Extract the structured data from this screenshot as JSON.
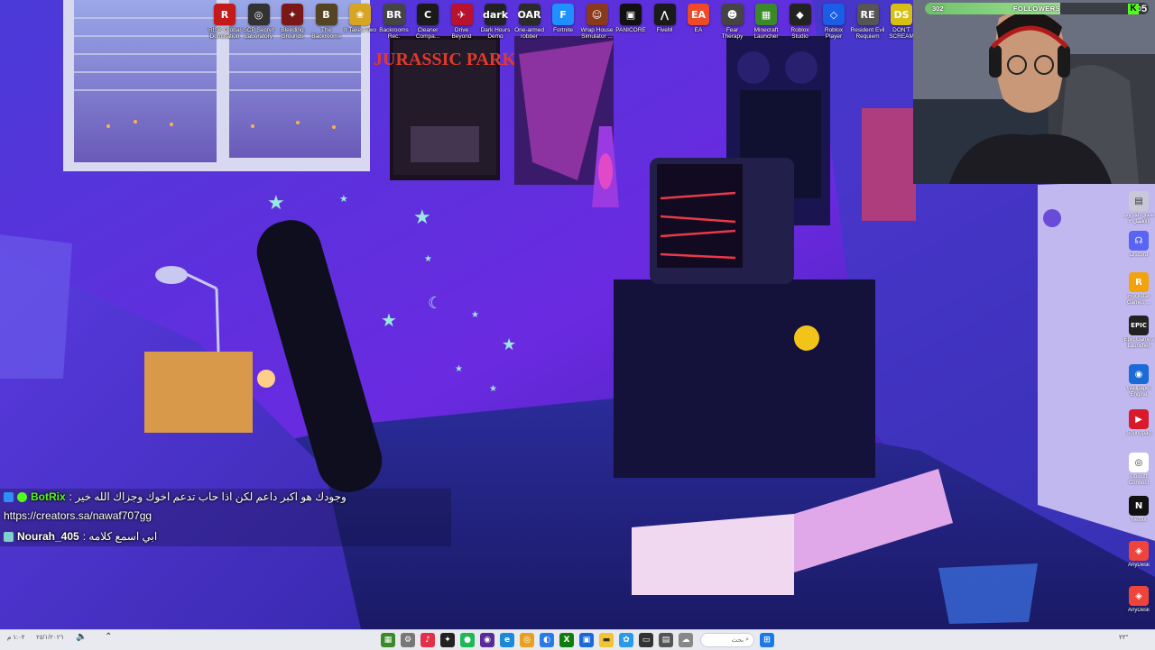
{
  "desktop_icons_top": [
    {
      "label": "RISK Global Domination",
      "icon": "risk-icon",
      "color": "#c41a1a",
      "glyph": "R"
    },
    {
      "label": "SCP Secret Laboratory",
      "icon": "scp-icon",
      "color": "#333333",
      "glyph": "◎"
    },
    {
      "label": "Bleeding Grounds",
      "icon": "bleed-icon",
      "color": "#7a1818",
      "glyph": "✦"
    },
    {
      "label": "The Backrooms",
      "icon": "backrooms-icon",
      "color": "#554422",
      "glyph": "B"
    },
    {
      "label": "It Takes Two",
      "icon": "ittakestwo-icon",
      "color": "#d6a524",
      "glyph": "❀"
    },
    {
      "label": "Backrooms Rec.",
      "icon": "br-icon",
      "color": "#444444",
      "glyph": "BR"
    },
    {
      "label": "Cleaner Compa...",
      "icon": "cleaner-icon",
      "color": "#1a1a1a",
      "glyph": "C"
    },
    {
      "label": "Drive Beyond Horizons",
      "icon": "drive-icon",
      "color": "#b8122e",
      "glyph": "✈"
    },
    {
      "label": "Dark Hours Demo",
      "icon": "darkhours-icon",
      "color": "#222222",
      "glyph": "dark"
    },
    {
      "label": "One-armed robber",
      "icon": "robber-icon",
      "color": "#2a2a2a",
      "glyph": "OAR"
    },
    {
      "label": "Fortnite",
      "icon": "fortnite-icon",
      "color": "#1e90ff",
      "glyph": "F"
    },
    {
      "label": "Wrap House Simulator ...",
      "icon": "wraphouse-icon",
      "color": "#8a3a1a",
      "glyph": "☺"
    },
    {
      "label": "PANICORE",
      "icon": "panicore-icon",
      "color": "#111111",
      "glyph": "▣"
    },
    {
      "label": "FiveM",
      "icon": "fivem-icon",
      "color": "#1a1a1a",
      "glyph": "⋀"
    },
    {
      "label": "EA",
      "icon": "ea-icon",
      "color": "#ef4a27",
      "glyph": "EA"
    },
    {
      "label": "Fear Therapy",
      "icon": "feartherapy-icon",
      "color": "#444444",
      "glyph": "☻"
    },
    {
      "label": "Minecraft Launcher",
      "icon": "minecraft-icon",
      "color": "#3a8a2a",
      "glyph": "▦"
    },
    {
      "label": "Roblox Studio",
      "icon": "robloxstudio-icon",
      "color": "#222222",
      "glyph": "◆"
    },
    {
      "label": "Roblox Player",
      "icon": "robloxplayer-icon",
      "color": "#1a5ee8",
      "glyph": "◇"
    },
    {
      "label": "Resident Evil Requiem",
      "icon": "re-icon",
      "color": "#555555",
      "glyph": "RE"
    },
    {
      "label": "DON'T SCREAM",
      "icon": "dontscream-icon",
      "color": "#d8c013",
      "glyph": "DS"
    }
  ],
  "desktop_icons_side": [
    {
      "label": "تحدي الجروب الأفضل ٢",
      "icon": "challenge-icon",
      "color": "#c8c8d8",
      "glyph": "▤"
    },
    {
      "label": "Discord",
      "icon": "discord-icon",
      "color": "#5865f2",
      "glyph": "☊"
    },
    {
      "label": "Rockstar Games ...",
      "icon": "rockstar-icon",
      "color": "#f2a20a",
      "glyph": "R"
    },
    {
      "label": "Epic Games Launcher",
      "icon": "epic-icon",
      "color": "#222222",
      "glyph": "EPIC"
    },
    {
      "label": "Wallpaper Engine",
      "icon": "wallpaperengine-icon",
      "color": "#1a6ad8",
      "glyph": "◉"
    },
    {
      "label": "Soundpad",
      "icon": "soundpad-icon",
      "color": "#d81a2a",
      "glyph": "▶"
    },
    {
      "label": "Ubisoft Connect",
      "icon": "ubisoft-icon",
      "color": "#ffffff",
      "glyph": "◎"
    },
    {
      "label": "Netflix",
      "icon": "netflix-icon",
      "color": "#111111",
      "glyph": "N"
    },
    {
      "label": "AnyDesk",
      "icon": "anydesk-icon",
      "color": "#ef443b",
      "glyph": "◈"
    },
    {
      "label": "AnyDesk",
      "icon": "anydesk-icon",
      "color": "#ef443b",
      "glyph": "◈"
    }
  ],
  "followers": {
    "current": "302",
    "title": "FOLLOWERS",
    "goal": "500",
    "progress": 0.604
  },
  "kick": {
    "logo": "K",
    "count": "5"
  },
  "chat": [
    {
      "user": "BotRix",
      "text": "وجودك هو اكبر داعم لكن اذا حاب تدعم اخوك وجزاك الله خير :",
      "user_color": "#53fc18",
      "badges": [
        "#2f8ef7",
        "#53fc18"
      ]
    },
    {
      "user": "",
      "text": "https://creators.sa/nawaf707gg",
      "user_color": "#ffffff",
      "badges": []
    },
    {
      "user": "Nourah_405",
      "text": "ابي اسمع كلامه :",
      "user_color": "#ffffff",
      "badges": [
        "#7fd1c9"
      ]
    }
  ],
  "taskbar": {
    "apps": [
      {
        "icon": "minecraft-taskbar-icon",
        "color": "#3a8a2a",
        "glyph": "▦"
      },
      {
        "icon": "settings-taskbar-icon",
        "color": "#777777",
        "glyph": "⚙"
      },
      {
        "icon": "app-red-taskbar-icon",
        "color": "#e0304a",
        "glyph": "♪"
      },
      {
        "icon": "app-dark-taskbar-icon",
        "color": "#222222",
        "glyph": "✦"
      },
      {
        "icon": "spotify-taskbar-icon",
        "color": "#1db954",
        "glyph": "●"
      },
      {
        "icon": "obs-taskbar-icon",
        "color": "#5a2a9a",
        "glyph": "◉"
      },
      {
        "icon": "edge-taskbar-icon",
        "color": "#1a8ad8",
        "glyph": "e"
      },
      {
        "icon": "chrome-taskbar-icon",
        "color": "#e8a020",
        "glyph": "◎"
      },
      {
        "icon": "browser-taskbar-icon",
        "color": "#2a7ae8",
        "glyph": "◐"
      },
      {
        "icon": "xbox-taskbar-icon",
        "color": "#107c10",
        "glyph": "X"
      },
      {
        "icon": "store-taskbar-icon",
        "color": "#1a6ad8",
        "glyph": "▣"
      },
      {
        "icon": "folder-taskbar-icon",
        "color": "#f2c430",
        "glyph": "▬"
      },
      {
        "icon": "photos-taskbar-icon",
        "color": "#2a9ae8",
        "glyph": "✿"
      },
      {
        "icon": "terminal-taskbar-icon",
        "color": "#333333",
        "glyph": "▭"
      },
      {
        "icon": "app2-taskbar-icon",
        "color": "#555555",
        "glyph": "▤"
      },
      {
        "icon": "cat-taskbar-icon",
        "color": "#888888",
        "glyph": "☁"
      }
    ],
    "search_label": "بحث",
    "clock_time": "١:٠٢ م",
    "clock_date": "٢٥/١/٢٠٢٦",
    "weather": "٢٢°"
  },
  "colors": {
    "accent": "#53fc18",
    "room_purple": "#5b2ad8",
    "wall_blue": "#3a3ac8"
  }
}
